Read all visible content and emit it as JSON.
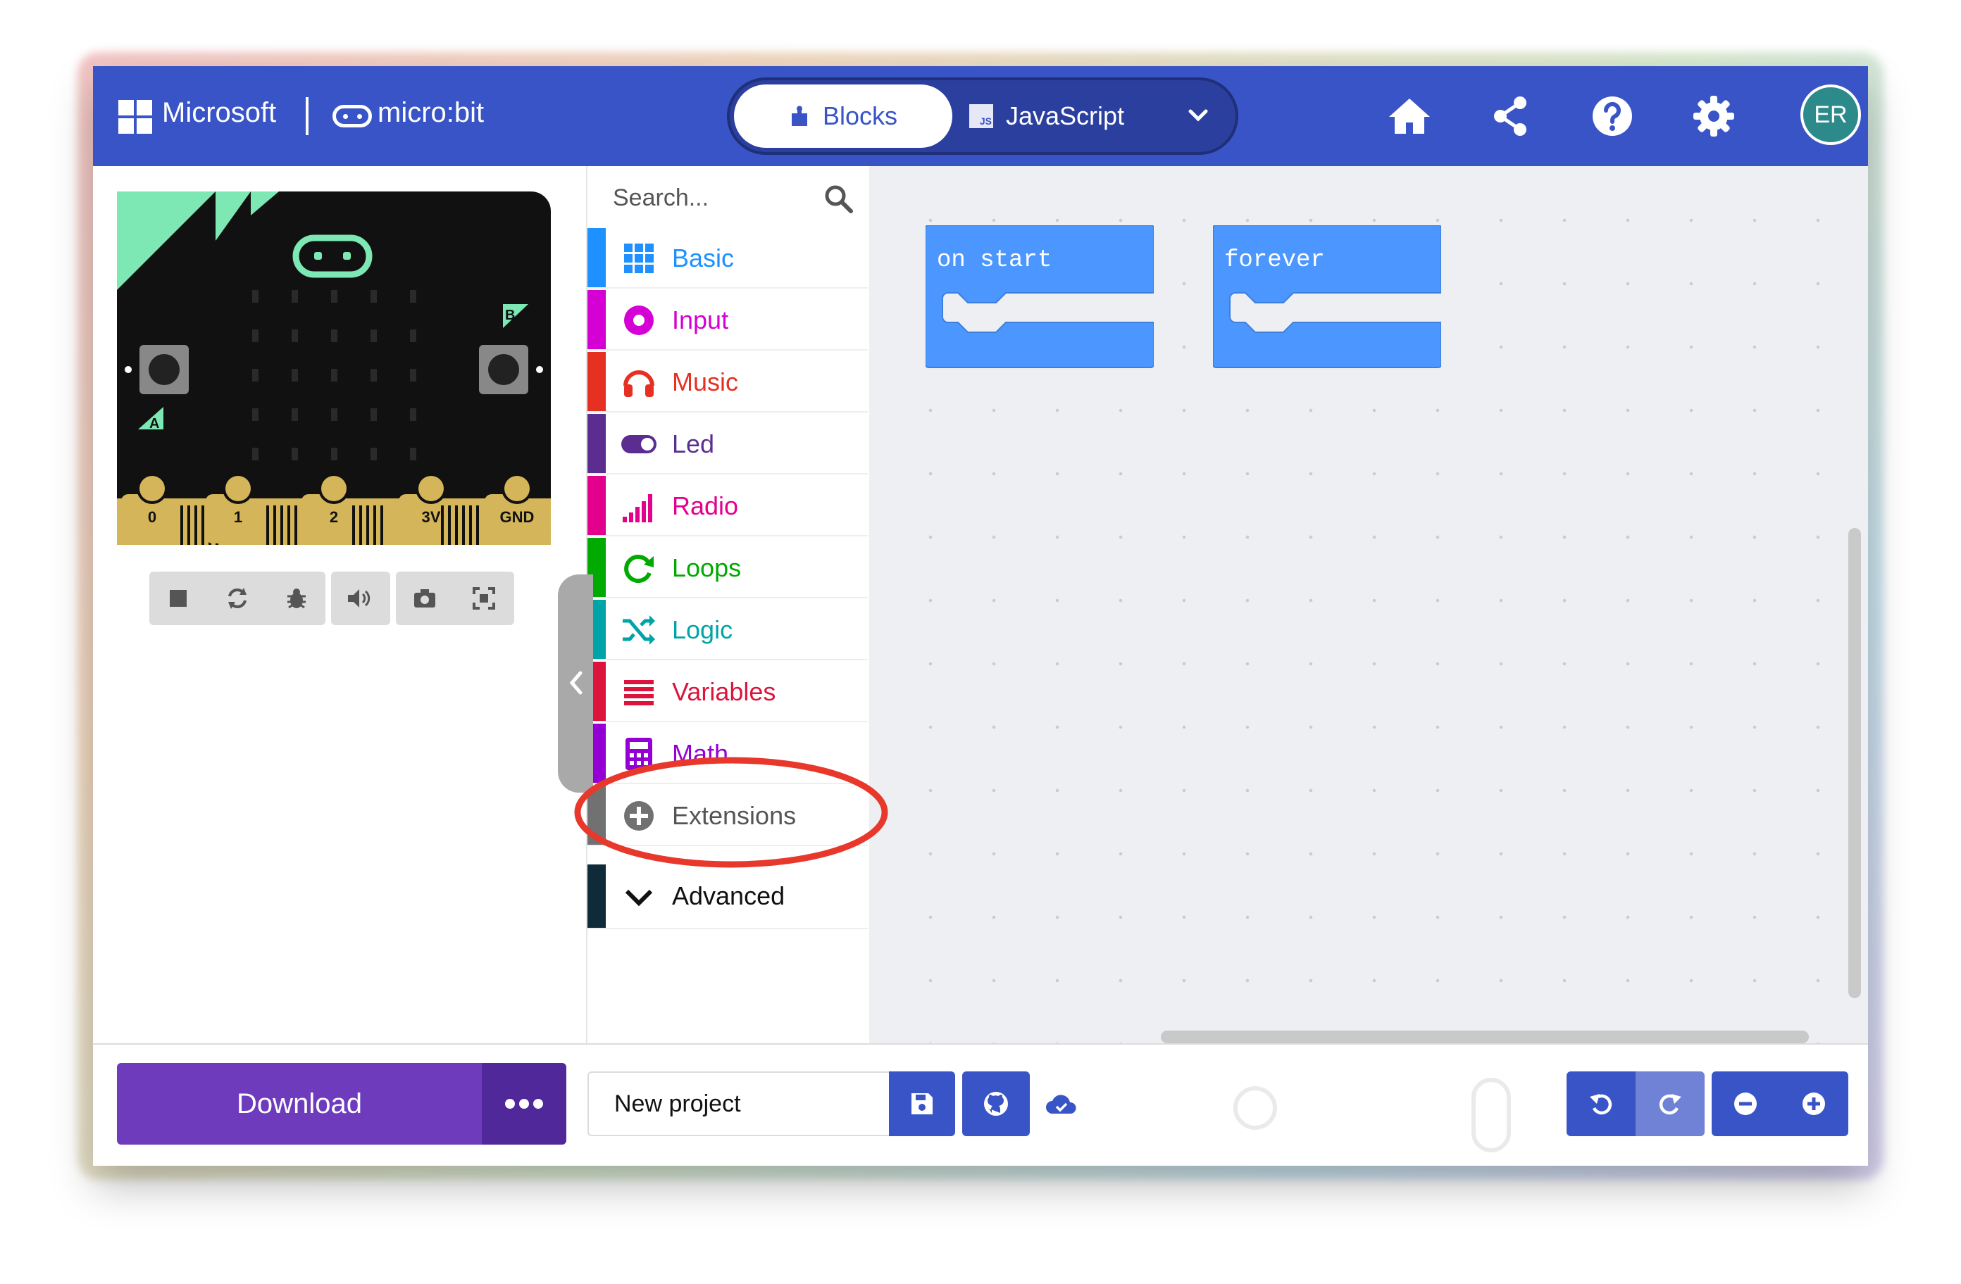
{
  "header": {
    "brand_microsoft": "Microsoft",
    "brand_microbit": "micro:bit",
    "tabs": [
      {
        "label": "Blocks",
        "active": true,
        "icon": "puzzle-icon"
      },
      {
        "label": "JavaScript",
        "active": false,
        "icon": "js-icon"
      }
    ],
    "js_badge": "JS",
    "icons": [
      "home-icon",
      "share-icon",
      "help-icon",
      "gear-icon"
    ],
    "avatar_initials": "ER",
    "color": "#3954c6"
  },
  "simulator": {
    "pins": [
      "0",
      "1",
      "2",
      "3V",
      "GND"
    ],
    "button_a": "A",
    "button_b": "B",
    "controls": [
      "stop-icon",
      "restart-icon",
      "debug-icon",
      "sound-icon",
      "screenshot-icon",
      "fullscreen-icon"
    ]
  },
  "toolbox": {
    "search_placeholder": "Search...",
    "categories": [
      {
        "label": "Basic",
        "color": "#1e90ff",
        "icon": "grid-icon"
      },
      {
        "label": "Input",
        "color": "#d400d4",
        "icon": "input-circle-icon"
      },
      {
        "label": "Music",
        "color": "#e63022",
        "icon": "headphones-icon"
      },
      {
        "label": "Led",
        "color": "#5c2d91",
        "icon": "toggle-icon"
      },
      {
        "label": "Radio",
        "color": "#e3008c",
        "icon": "signal-bars-icon"
      },
      {
        "label": "Loops",
        "color": "#00aa00",
        "icon": "refresh-icon"
      },
      {
        "label": "Logic",
        "color": "#00a4a6",
        "icon": "shuffle-icon"
      },
      {
        "label": "Variables",
        "color": "#dc143c",
        "icon": "list-icon"
      },
      {
        "label": "Math",
        "color": "#9400d3",
        "icon": "calculator-icon"
      },
      {
        "label": "Extensions",
        "color": "#717171",
        "icon": "plus-circle-icon"
      },
      {
        "label": "Advanced",
        "color": "#0f2b3a",
        "icon": "chevron-down-icon"
      }
    ]
  },
  "workspace": {
    "blocks": [
      {
        "label": "on start"
      },
      {
        "label": "forever"
      }
    ],
    "block_color": "#4c97ff",
    "annotation": "red circle around Extensions"
  },
  "footer": {
    "download_label": "Download",
    "project_name": "New project",
    "icons": [
      "save-icon",
      "github-icon",
      "cloud-icon",
      "undo-icon",
      "redo-icon",
      "zoom-out-icon",
      "zoom-in-icon"
    ]
  }
}
